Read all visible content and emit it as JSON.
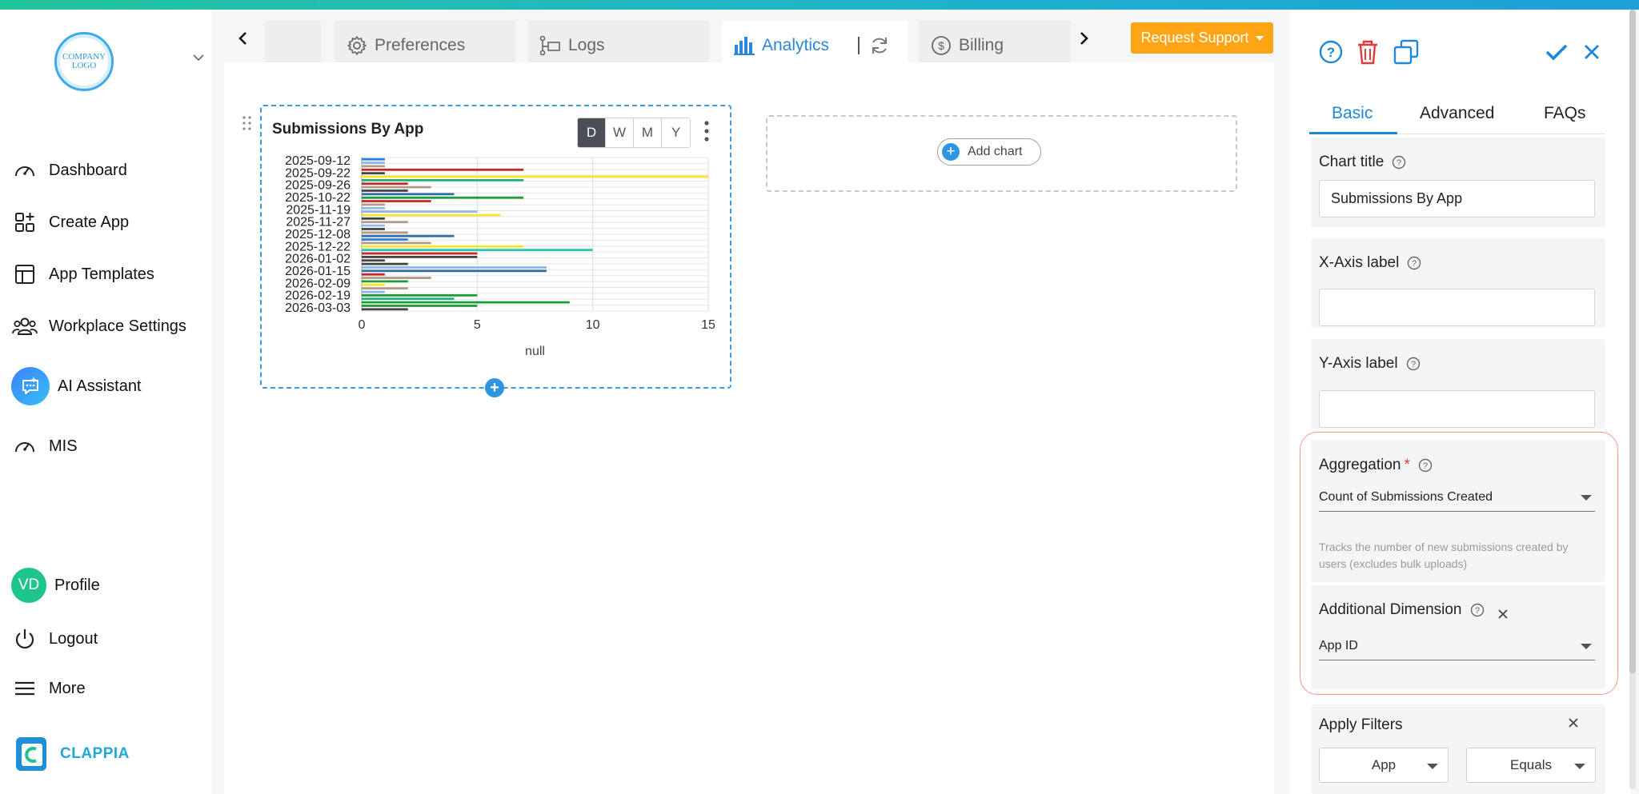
{
  "sidebar": {
    "logo_text": "COMPANY LOGO",
    "items": [
      {
        "label": "Dashboard",
        "icon": "gauge-icon"
      },
      {
        "label": "Create App",
        "icon": "grid-plus-icon"
      },
      {
        "label": "App Templates",
        "icon": "template-icon"
      },
      {
        "label": "Workplace Settings",
        "icon": "users-icon"
      },
      {
        "label": "AI Assistant",
        "icon": "ai-chat-icon"
      },
      {
        "label": "MIS",
        "icon": "gauge-icon"
      },
      {
        "label": "Profile",
        "icon": "avatar",
        "avatar_text": "VD"
      },
      {
        "label": "Logout",
        "icon": "power-icon"
      },
      {
        "label": "More",
        "icon": "hamburger-icon"
      }
    ],
    "brand": "CLAPPIA"
  },
  "tabs": [
    {
      "label": "Preferences",
      "icon": "gear-icon"
    },
    {
      "label": "Logs",
      "icon": "logs-icon"
    },
    {
      "label": "Analytics",
      "icon": "bar-chart-icon",
      "active": true
    },
    {
      "label": "Billing",
      "icon": "dollar-icon"
    }
  ],
  "request_support": "Request Support",
  "card": {
    "title": "Submissions By App",
    "periods": [
      "D",
      "W",
      "M",
      "Y"
    ],
    "active_period": "D",
    "add_chart": "Add chart"
  },
  "chart_data": {
    "type": "bar",
    "orientation": "horizontal",
    "title": "Submissions By App",
    "xlabel": "null",
    "xlim": [
      0,
      15
    ],
    "xticks": [
      0,
      5,
      10,
      15
    ],
    "ytick_labels": [
      "2025-09-12",
      "2025-09-22",
      "2025-09-26",
      "2025-10-22",
      "2025-11-19",
      "2025-11-27",
      "2025-12-08",
      "2025-12-22",
      "2026-01-02",
      "2026-01-15",
      "2026-02-09",
      "2026-02-19",
      "2026-03-03"
    ],
    "grid": true,
    "colors": [
      "#2a7de1",
      "#c62828",
      "#f5e62a",
      "#21b07a",
      "#8fb7e8",
      "#b29a86",
      "#444444",
      "#1d9c3a",
      "#2e6fa8",
      "#27c6b0",
      "#e06c6c"
    ],
    "bars": [
      {
        "value": 1,
        "color": 0
      },
      {
        "value": 1,
        "color": 4
      },
      {
        "value": 1,
        "color": 5
      },
      {
        "value": 7,
        "color": 1
      },
      {
        "value": 1,
        "color": 6
      },
      {
        "value": 15,
        "color": 2
      },
      {
        "value": 7,
        "color": 3
      },
      {
        "value": 2,
        "color": 1
      },
      {
        "value": 3,
        "color": 5
      },
      {
        "value": 2,
        "color": 6
      },
      {
        "value": 4,
        "color": 8
      },
      {
        "value": 7,
        "color": 7
      },
      {
        "value": 3,
        "color": 1
      },
      {
        "value": 1,
        "color": 5
      },
      {
        "value": 1,
        "color": 4
      },
      {
        "value": 5,
        "color": 4
      },
      {
        "value": 6,
        "color": 2
      },
      {
        "value": 1,
        "color": 6
      },
      {
        "value": 2,
        "color": 5
      },
      {
        "value": 1,
        "color": 4
      },
      {
        "value": 1,
        "color": 6
      },
      {
        "value": 2,
        "color": 5
      },
      {
        "value": 4,
        "color": 8
      },
      {
        "value": 2,
        "color": 0
      },
      {
        "value": 3,
        "color": 5
      },
      {
        "value": 7,
        "color": 2
      },
      {
        "value": 10,
        "color": 9
      },
      {
        "value": 5,
        "color": 1
      },
      {
        "value": 5,
        "color": 6
      },
      {
        "value": 1,
        "color": 6
      },
      {
        "value": 2,
        "color": 6
      },
      {
        "value": 8,
        "color": 4
      },
      {
        "value": 8,
        "color": 8
      },
      {
        "value": 1,
        "color": 1
      },
      {
        "value": 3,
        "color": 5
      },
      {
        "value": 2,
        "color": 7
      },
      {
        "value": 1,
        "color": 2
      },
      {
        "value": 2,
        "color": 5
      },
      {
        "value": 1,
        "color": 4
      },
      {
        "value": 5,
        "color": 7
      },
      {
        "value": 4,
        "color": 3
      },
      {
        "value": 9,
        "color": 7
      },
      {
        "value": 5,
        "color": 7
      },
      {
        "value": 2,
        "color": 6
      }
    ]
  },
  "panel": {
    "tabs": [
      "Basic",
      "Advanced",
      "FAQs"
    ],
    "active_tab": "Basic",
    "chart_title_label": "Chart title",
    "chart_title_value": "Submissions By App",
    "x_axis_label": "X-Axis label",
    "x_axis_value": "",
    "y_axis_label": "Y-Axis label",
    "y_axis_value": "",
    "aggregation_label": "Aggregation",
    "required_mark": "*",
    "aggregation_value": "Count of Submissions Created",
    "aggregation_hint": "Tracks the number of new submissions created by users (excludes bulk uploads)",
    "dimension_label": "Additional Dimension",
    "dimension_value": "App ID",
    "filters_label": "Apply Filters",
    "filter_field": "App",
    "filter_operator": "Equals"
  },
  "colors": {
    "accent": "#1e88d6",
    "support": "#ffa515",
    "delete": "#e53935",
    "highlight": "#f19a86"
  }
}
